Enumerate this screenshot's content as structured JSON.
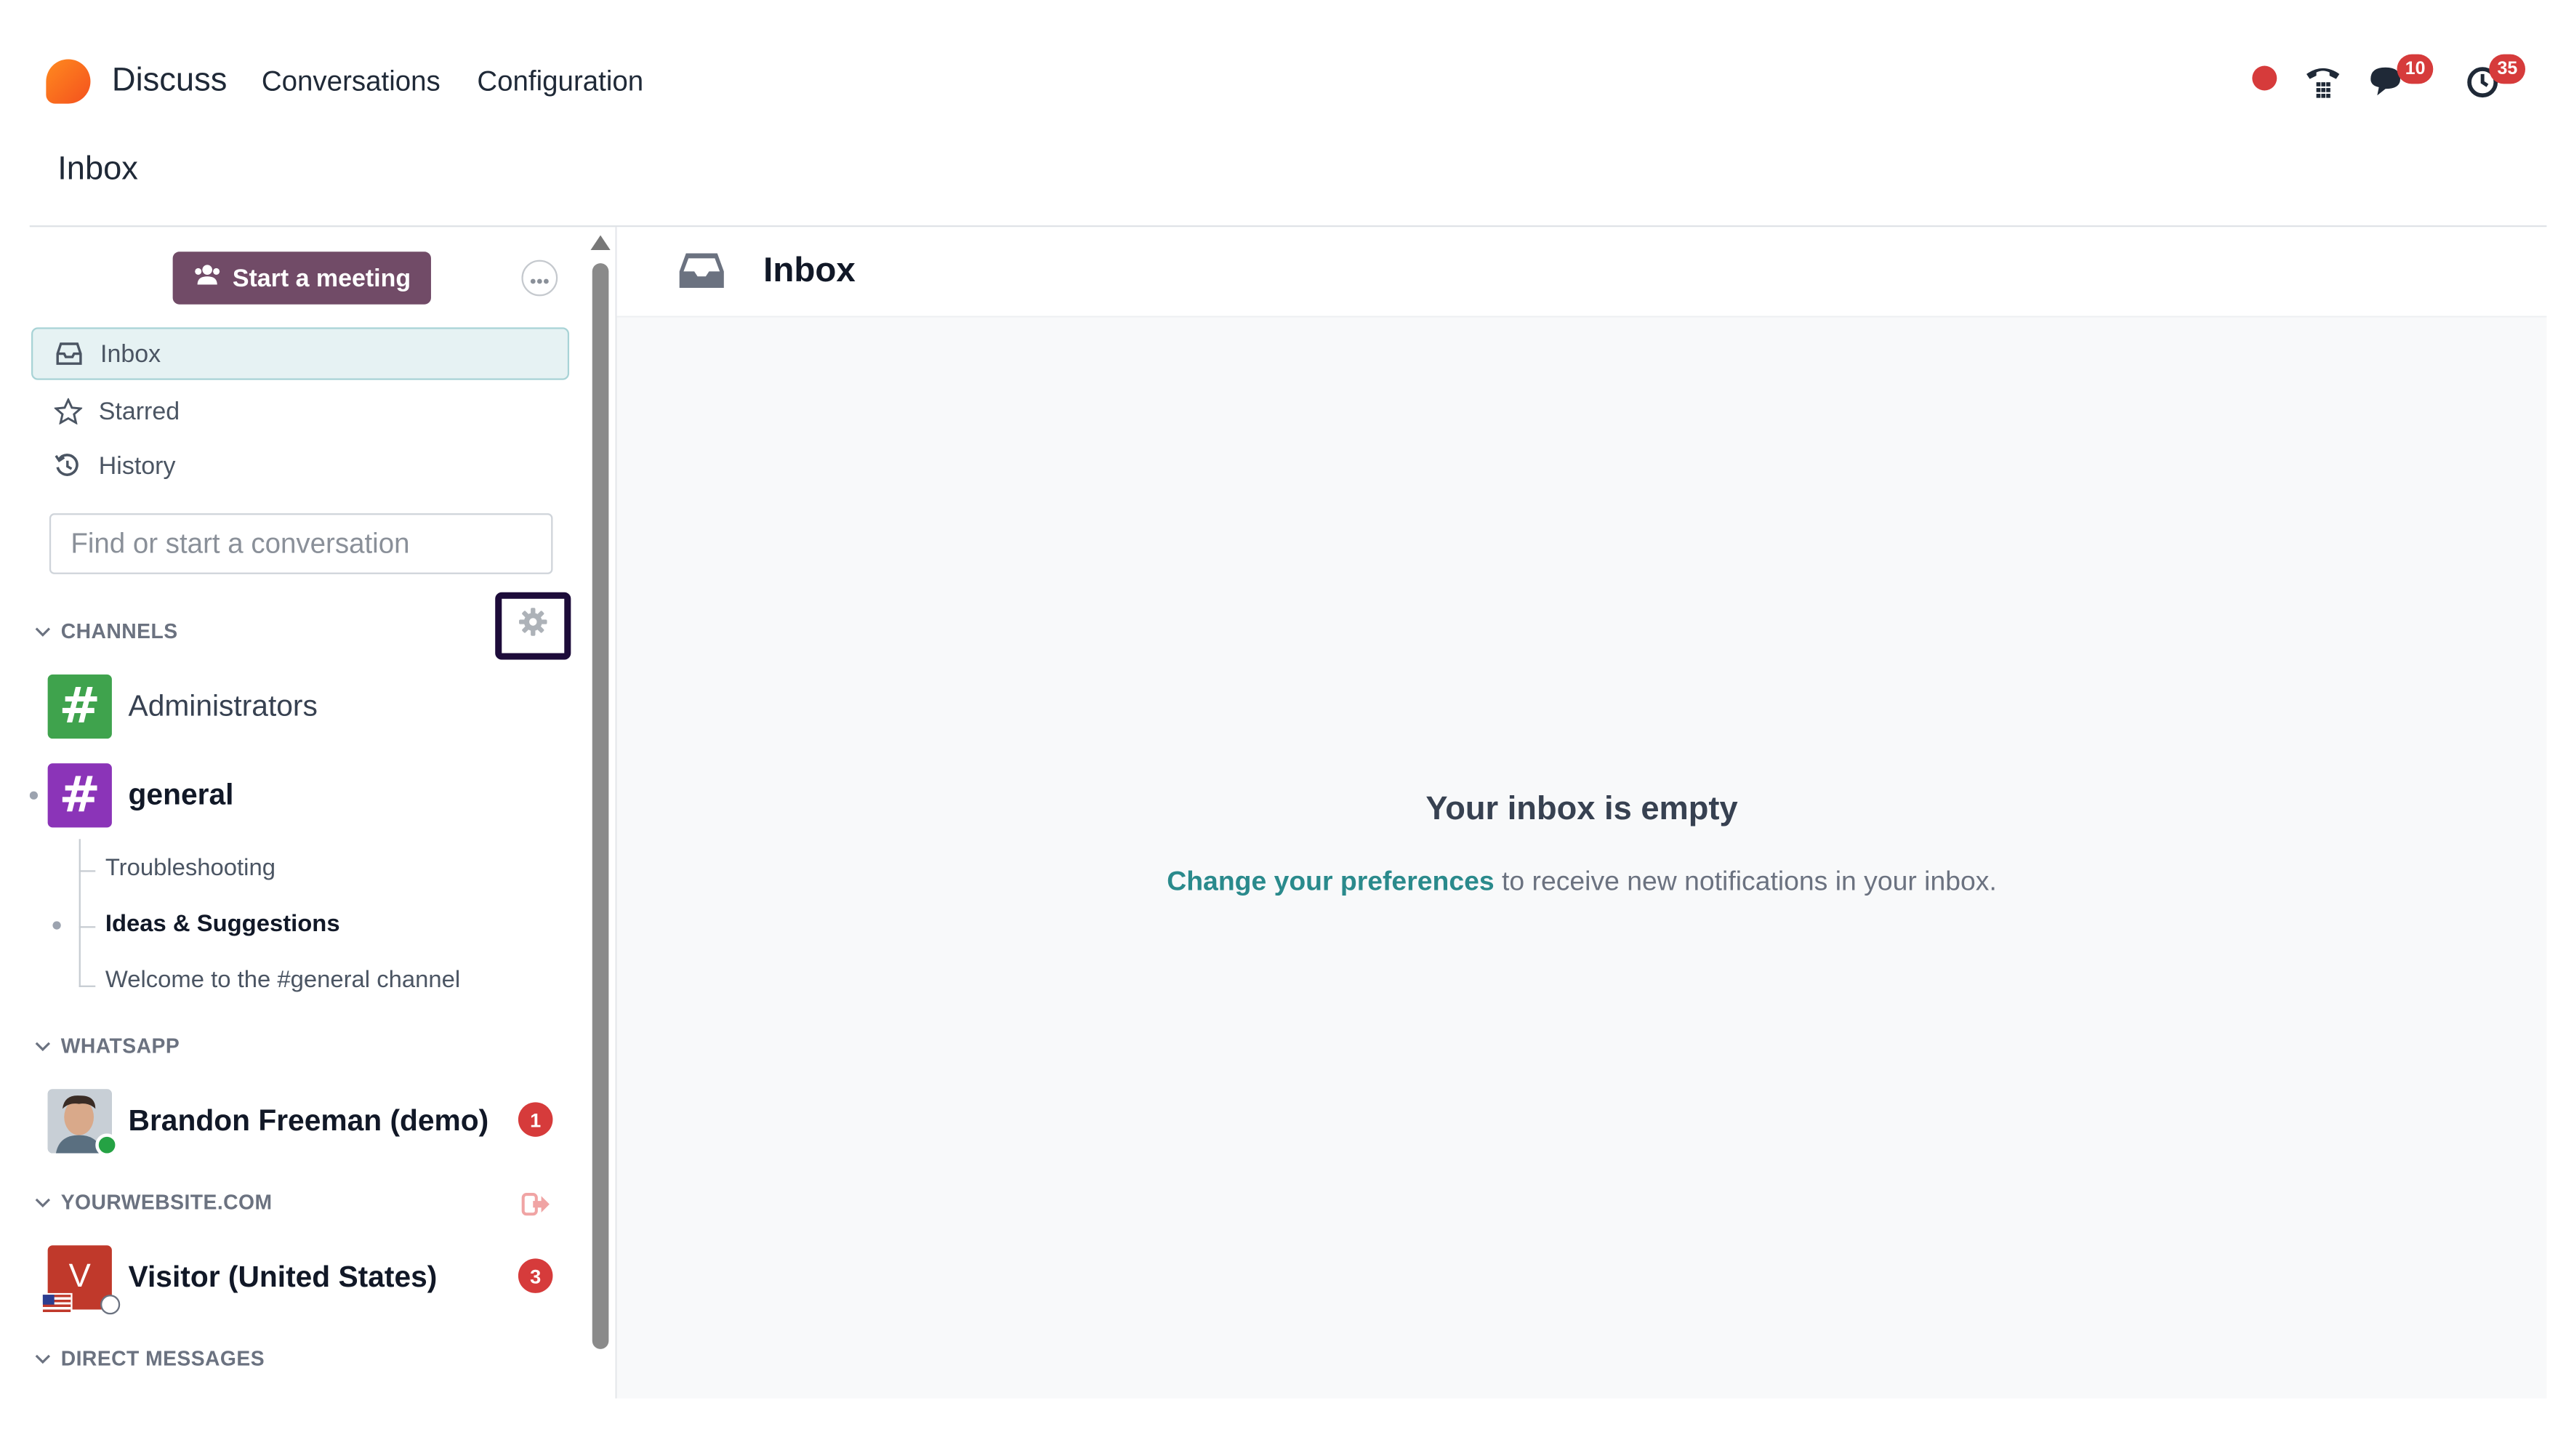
{
  "app": {
    "name": "Discuss",
    "menu": [
      "Conversations",
      "Configuration"
    ],
    "breadcrumb": "Inbox"
  },
  "systray": {
    "messages_count": "10",
    "activities_count": "35"
  },
  "sidebar": {
    "start_meeting_label": "Start a meeting",
    "nav": [
      {
        "label": "Inbox",
        "icon": "inbox-icon",
        "active": true
      },
      {
        "label": "Starred",
        "icon": "star-icon",
        "active": false
      },
      {
        "label": "History",
        "icon": "history-icon",
        "active": false
      }
    ],
    "search_placeholder": "Find or start a conversation",
    "sections": {
      "channels": "CHANNELS",
      "whatsapp": "WHATSAPP",
      "website": "YOURWEBSITE.COM",
      "direct": "DIRECT MESSAGES"
    },
    "channels": [
      {
        "name": "Administrators",
        "color": "#3fa34d"
      },
      {
        "name": "general",
        "color": "#8b34b8"
      }
    ],
    "threads": [
      "Troubleshooting",
      "Ideas & Suggestions",
      "Welcome to the #general channel"
    ],
    "whatsapp_contact": {
      "name": "Brandon Freeman (demo)",
      "unread": "1"
    },
    "visitor": {
      "initial": "V",
      "name": "Visitor (United States)",
      "unread": "3"
    }
  },
  "main": {
    "title": "Inbox",
    "empty_title": "Your inbox is empty",
    "empty_link": "Change your preferences",
    "empty_rest": " to receive new notifications in your inbox."
  },
  "colors": {
    "primary": "#714b67",
    "accent_teal": "#2a8a8c",
    "badge_red": "#d63b3b"
  }
}
